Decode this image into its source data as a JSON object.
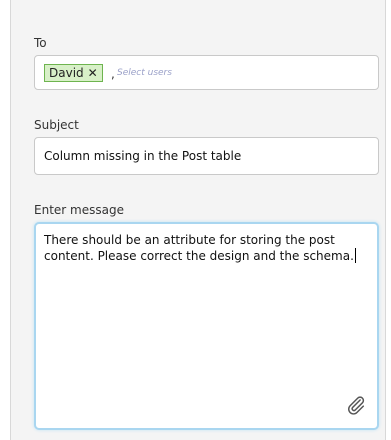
{
  "form": {
    "to_label": "To",
    "recipients": [
      {
        "name": "David",
        "remove_glyph": "✕"
      }
    ],
    "separator": ",",
    "to_placeholder": "Select users",
    "subject_label": "Subject",
    "subject_value": "Column missing in the Post table",
    "message_label": "Enter message",
    "message_value": "There should be an attribute for storing the post content. Please correct the design and the schema."
  },
  "icons": {
    "attachment": "paperclip-icon",
    "remove": "close-icon"
  },
  "colors": {
    "tag_background": "#d8f0c8",
    "tag_border": "#6eb44f",
    "placeholder": "#9aa0c8",
    "focus_border": "#a9d6f0",
    "panel_background": "#f4f4f4"
  }
}
